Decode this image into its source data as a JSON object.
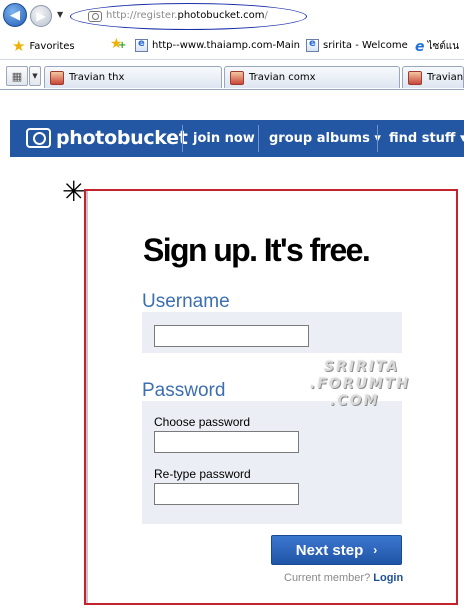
{
  "browser": {
    "url_prefix": "http://register.",
    "url_domain": "photobucket.com",
    "url_suffix": "/",
    "favorites_label": "Favorites",
    "favorites_links": [
      "http--www.thaiamp.com-Main",
      "sririta - Welcome",
      "ไซต์แน"
    ],
    "tabs": [
      "Travian thx",
      "Travian comx",
      "Travian"
    ]
  },
  "photobucket": {
    "logo": "photobucket",
    "nav": {
      "join_now": "join now",
      "group_albums": "group albums ▾",
      "find_stuff": "find stuff ▾"
    }
  },
  "annotation": {
    "asterisk": "✳"
  },
  "signup": {
    "heading": "Sign up. It's free.",
    "username_section": "Username",
    "password_section": "Password",
    "choose_password_label": "Choose password",
    "retype_password_label": "Re-type password",
    "next_button": "Next step",
    "next_arrow": "›",
    "current_member_text": "Current member?",
    "login_link": "Login",
    "username_value": "",
    "choose_password_value": "",
    "retype_password_value": ""
  },
  "watermark": [
    "SRIRITA",
    ".FORUMTH",
    ".COM"
  ],
  "colors": {
    "nav_blue": "#2356a3",
    "section_blue": "#3c6eb0",
    "border_red": "#c4232d",
    "panel_gray": "#ebeff5"
  }
}
